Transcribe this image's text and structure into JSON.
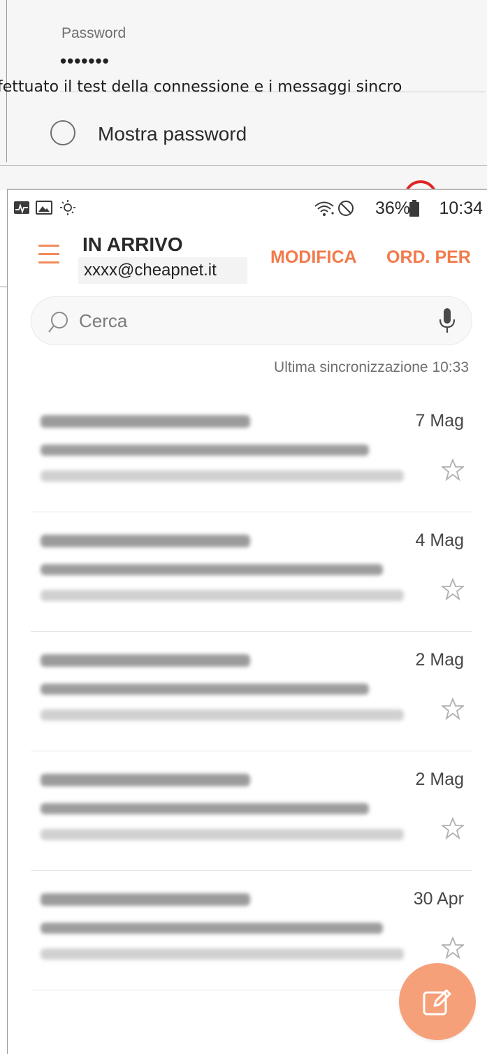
{
  "background_screen": {
    "password_label": "Password",
    "password_value": "•••••••",
    "overlay_text": "fettuato il test della connessione e i messaggi sincro",
    "show_password_label": "Mostra password"
  },
  "status_bar": {
    "battery_percent": "36%",
    "time": "10:34",
    "icons": [
      "activity-icon",
      "image-icon",
      "brightness-icon",
      "wifi-icon",
      "do-not-disturb-icon",
      "battery-icon"
    ]
  },
  "header": {
    "title": "IN ARRIVO",
    "account": "xxxx@cheapnet.it",
    "edit_label": "MODIFICA",
    "sort_label": "ORD. PER"
  },
  "search": {
    "placeholder": "Cerca"
  },
  "sync_info": "Ultima sincronizzazione  10:33",
  "emails": [
    {
      "date": "7 Mag"
    },
    {
      "date": "4 Mag"
    },
    {
      "date": "2 Mag"
    },
    {
      "date": "2 Mag"
    },
    {
      "date": "30 Apr"
    }
  ],
  "colors": {
    "accent": "#f27a4a",
    "fab": "#f6a07a"
  }
}
